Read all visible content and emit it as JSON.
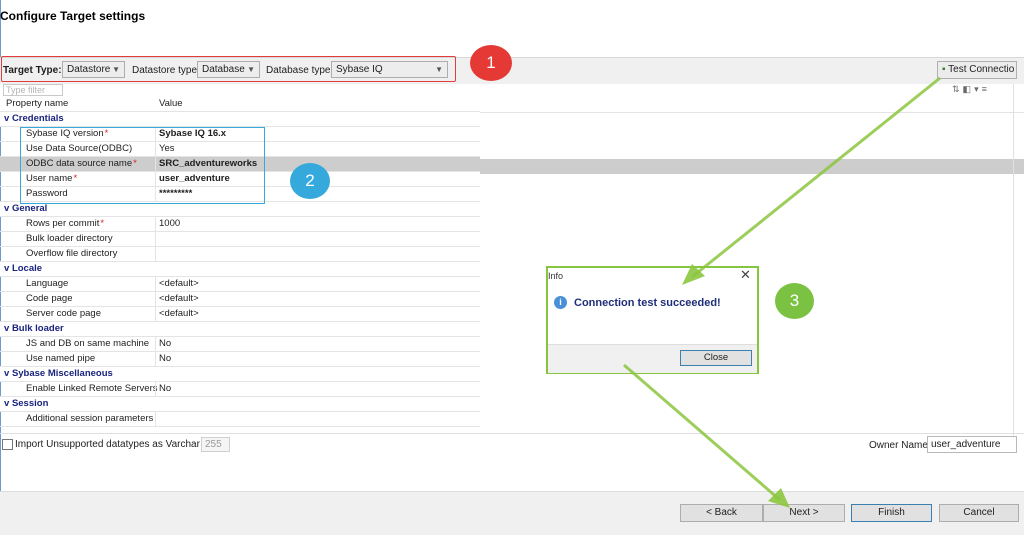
{
  "window": {
    "title": "Configure Target settings"
  },
  "toolbar": {
    "target_type_label": "Target Type:",
    "target_type_value": "Datastore",
    "datastore_type_label": "Datastore type:",
    "datastore_type_value": "Database",
    "database_type_label": "Database type:",
    "database_type_value": "Sybase IQ",
    "test_connection_label": "Test Connectio"
  },
  "filter": {
    "placeholder": "Type filter"
  },
  "grid": {
    "headers": {
      "property": "Property name",
      "value": "Value"
    },
    "categories": {
      "credentials": "Credentials",
      "general": "General",
      "locale": "Locale",
      "bulk_loader": "Bulk loader",
      "sybase_misc": "Sybase Miscellaneous",
      "session": "Session"
    },
    "rows": {
      "iq_version": {
        "name": "Sybase IQ version",
        "value": "Sybase IQ 16.x"
      },
      "use_odbc": {
        "name": "Use Data Source(ODBC)",
        "value": "Yes"
      },
      "odbc_name": {
        "name": "ODBC data source name",
        "value": "SRC_adventureworks"
      },
      "user_name": {
        "name": "User name",
        "value": "user_adventure"
      },
      "password": {
        "name": "Password",
        "value": "*********"
      },
      "rows_per_commit": {
        "name": "Rows per commit",
        "value": "1000"
      },
      "bulk_dir": {
        "name": "Bulk loader directory",
        "value": ""
      },
      "overflow_dir": {
        "name": "Overflow file directory",
        "value": ""
      },
      "language": {
        "name": "Language",
        "value": "<default>"
      },
      "code_page": {
        "name": "Code page",
        "value": "<default>"
      },
      "server_code_page": {
        "name": "Server code page",
        "value": "<default>"
      },
      "js_db_same": {
        "name": "JS and DB on same machine",
        "value": "No"
      },
      "named_pipe": {
        "name": "Use named pipe",
        "value": "No"
      },
      "linked_servers": {
        "name": "Enable Linked Remote Servers",
        "value": "No"
      },
      "session_params": {
        "name": "Additional session parameters",
        "value": ""
      }
    },
    "required_mark": "*"
  },
  "options": {
    "import_varchar_label": "Import Unsupported datatypes as Varchar",
    "varchar_size": "255",
    "owner_label": "Owner Name",
    "owner_value": "user_adventure"
  },
  "dialog": {
    "title": "Info",
    "message": "Connection test succeeded!",
    "close_label": "Close"
  },
  "buttons": {
    "back": "< Back",
    "next": "Next >",
    "finish": "Finish",
    "cancel": "Cancel"
  },
  "annotations": {
    "badge1": "1",
    "badge2": "2",
    "badge3": "3"
  },
  "colors": {
    "red_annotation": "#e53935",
    "blue_annotation": "#35a9dc",
    "green_annotation": "#7cc242"
  }
}
